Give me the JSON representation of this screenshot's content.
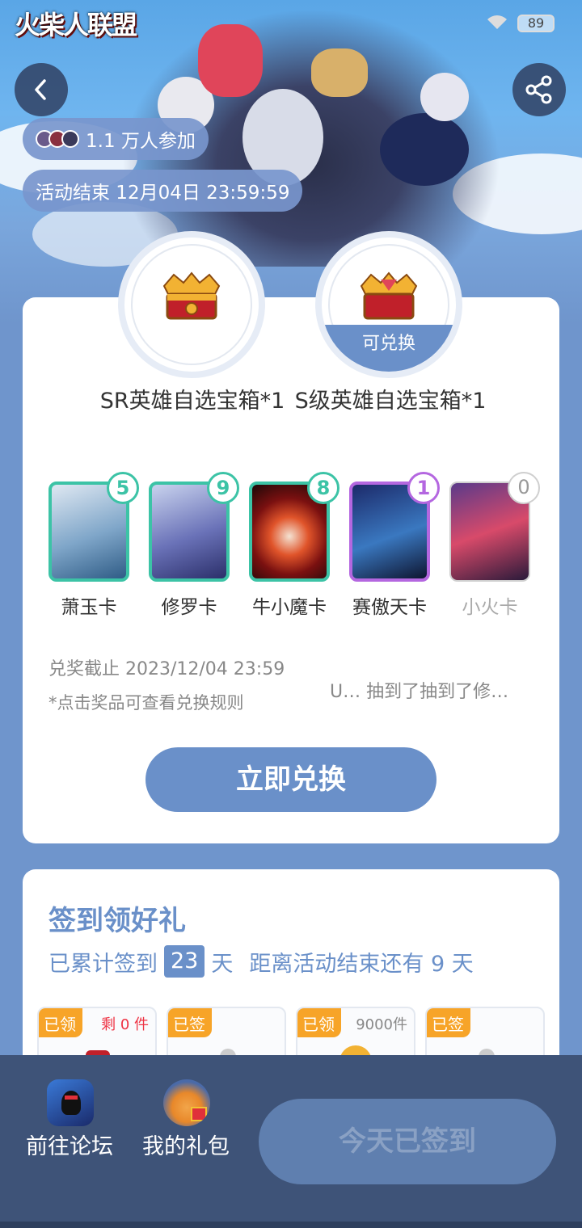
{
  "status": {
    "battery": "89"
  },
  "header": {
    "game_logo": "火柴人联盟",
    "participants": "1.1 万人参加",
    "end_time": "活动结束 12月04日 23:59:59"
  },
  "rewards": [
    {
      "name": "SR英雄自选宝箱*1",
      "tag": ""
    },
    {
      "name": "S级英雄自选宝箱*1",
      "tag": "可兑换"
    }
  ],
  "hero_cards": [
    {
      "label": "萧玉卡",
      "count": "5",
      "color": "#3cc3a6"
    },
    {
      "label": "修罗卡",
      "count": "9",
      "color": "#3cc3a6"
    },
    {
      "label": "牛小魔卡",
      "count": "8",
      "color": "#3cc3a6"
    },
    {
      "label": "赛傲天卡",
      "count": "1",
      "color": "#b467e0"
    },
    {
      "label": "小火卡",
      "count": "0",
      "color": "#cfcfcf"
    }
  ],
  "exchange": {
    "deadline": "兑奖截止 2023/12/04 23:59",
    "rule_note": "*点击奖品可查看兑换规则",
    "ticker": "U… 抽到了抽到了修…",
    "button": "立即兑换"
  },
  "signin": {
    "title": "签到领好礼",
    "prefix": "已累计签到",
    "days": "23",
    "unit": "天",
    "remaining": "距离活动结束还有 9 天"
  },
  "day_tiles": [
    {
      "tag": "已领",
      "count": "剩 0 件"
    },
    {
      "tag": "已签",
      "count": ""
    },
    {
      "tag": "已领",
      "count": "9000件"
    },
    {
      "tag": "已签",
      "count": ""
    }
  ],
  "bottom": {
    "forum": "前往论坛",
    "gifts": "我的礼包",
    "signed_button": "今天已签到"
  },
  "colors": {
    "accent": "#6a90c9",
    "bottom_bar": "#3e5378",
    "tag": "#f7a428"
  }
}
